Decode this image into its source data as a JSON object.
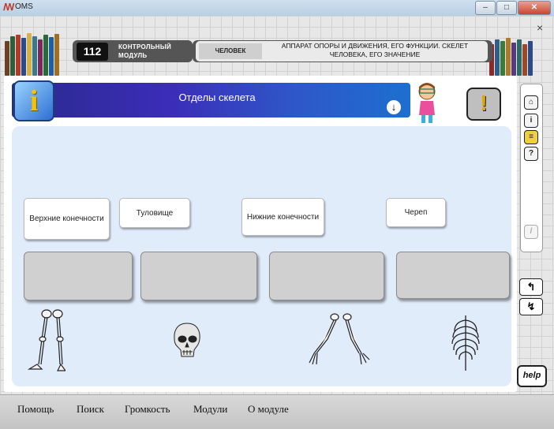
{
  "window": {
    "title": "OMS",
    "minimize_glyph": "–",
    "maximize_glyph": "□",
    "close_glyph": "✕",
    "inner_close_glyph": "×"
  },
  "module": {
    "number": "112",
    "label": "КОНТРОЛЬНЫЙ МОДУЛЬ",
    "tag": "ЧЕЛОВЕК",
    "topic": "АППАРАТ ОПОРЫ И ДВИЖЕНИЯ, ЕГО ФУНКЦИИ. СКЕЛЕТ ЧЕЛОВЕКА, ЕГО ЗНАЧЕНИЕ"
  },
  "banner": {
    "title": "Отделы скелета",
    "info_glyph": "i",
    "alert_glyph": "!",
    "down_glyph": "↓"
  },
  "labels": [
    {
      "text": "Верхние конечности"
    },
    {
      "text": "Туловище"
    },
    {
      "text": "Нижние конечности"
    },
    {
      "text": "Череп"
    }
  ],
  "drop_zones": 4,
  "sidebar": {
    "buttons": [
      "home-icon",
      "info-icon",
      "book-icon",
      "question-icon"
    ],
    "disabled_glyph": "/"
  },
  "nav": {
    "back_glyph": "↰",
    "forward_glyph": "↯"
  },
  "help": {
    "label": "help"
  },
  "menu": [
    {
      "label": "Помощь"
    },
    {
      "label": "Поиск"
    },
    {
      "label": "Громкость"
    },
    {
      "label": "Модули"
    },
    {
      "label": "О модуле"
    }
  ],
  "colors": {
    "banner": "#3b2db8",
    "workarea": "#e1ecfb",
    "drop_zone": "#d0d0d0"
  }
}
